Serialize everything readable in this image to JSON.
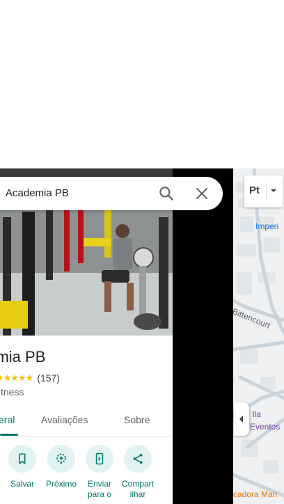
{
  "search": {
    "query": "Academia PB"
  },
  "place": {
    "title": "Academia PB",
    "title_visible": "demia PB",
    "rating_count": "(157)",
    "category": "fitness"
  },
  "tabs": [
    {
      "label": "eral",
      "active": true
    },
    {
      "label": "Avaliações",
      "active": false
    },
    {
      "label": "Sobre",
      "active": false
    }
  ],
  "actions": [
    {
      "label": "Salvar",
      "icon": "bookmark-icon"
    },
    {
      "label": "Próximo",
      "icon": "nearby-icon"
    },
    {
      "label": "Enviar para o",
      "icon": "send-to-phone-icon"
    },
    {
      "label": "Compartilhar",
      "label_display": "Compart\nilhar",
      "icon": "share-icon"
    }
  ],
  "map": {
    "labels": [
      {
        "text": "Imperi",
        "color": "#1a73e8"
      },
      {
        "text": "Bittencourt",
        "color": "#5f6368"
      },
      {
        "text": "lla",
        "color": "#7b3fb3"
      },
      {
        "text": "Eventos",
        "color": "#7b3fb3"
      },
      {
        "text": "cadora Man",
        "color": "#e8710a"
      }
    ],
    "layers_glyph": "Pt"
  },
  "colors": {
    "accent": "#00796b",
    "accent_bg": "#e0f2f1",
    "star": "#fbbc04"
  }
}
